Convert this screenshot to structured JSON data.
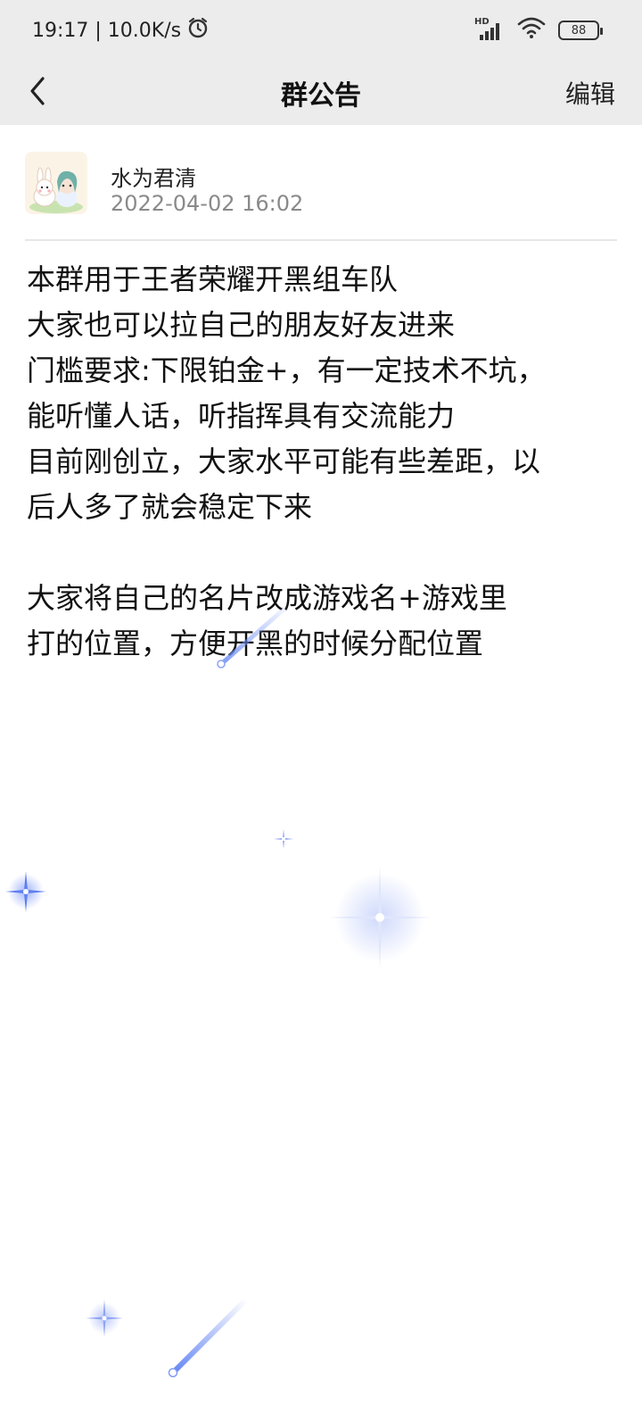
{
  "status_bar": {
    "time_speed": "19:17 | 10.0K/s",
    "network_label": "HD",
    "battery": "88"
  },
  "nav": {
    "title": "群公告",
    "edit_label": "编辑"
  },
  "author": {
    "name": "水为君清",
    "timestamp": "2022-04-02 16:02"
  },
  "announcement": {
    "lines": [
      "本群用于王者荣耀开黑组车队",
      "大家也可以拉自己的朋友好友进来",
      "门槛要求:下限铂金+，有一定技术不坑，",
      "能听懂人话，听指挥具有交流能力",
      "目前刚创立，大家水平可能有些差距，以",
      "后人多了就会稳定下来",
      "",
      "大家将自己的名片改成游戏名+游戏里",
      "打的位置，方便开黑的时候分配位置"
    ]
  },
  "colors": {
    "status_bg": "#ececec",
    "page_bg": "#ffffff",
    "timestamp": "#8a8a8a",
    "sparkle": "#6f8ff5"
  }
}
